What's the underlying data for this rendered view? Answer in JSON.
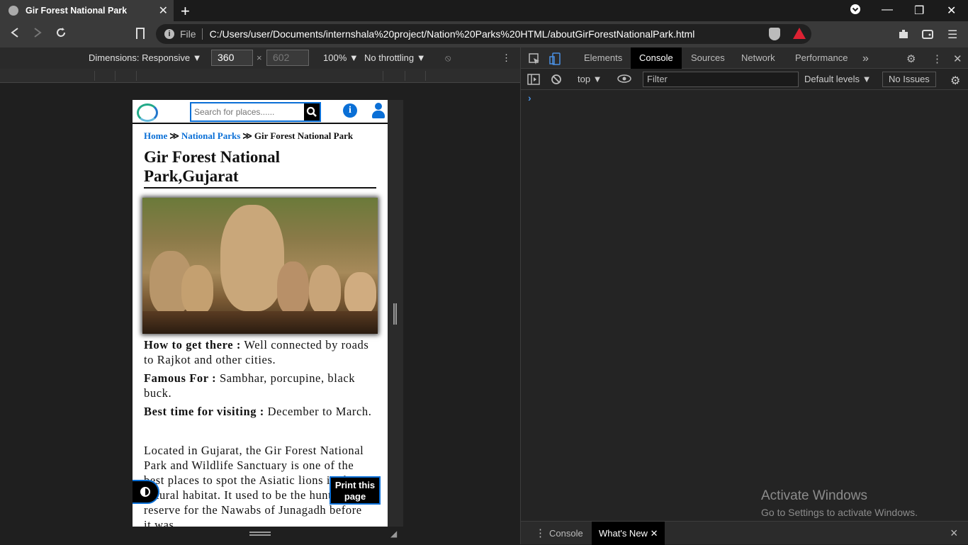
{
  "browser": {
    "tab_title": "Gir Forest National Park",
    "tab_close": "✕",
    "new_tab": "+",
    "url_scheme_label": "File",
    "url": "C:/Users/user/Documents/internshala%20project/Nation%20Parks%20HTML/aboutGirForestNationalPark.html"
  },
  "device_toolbar": {
    "dimensions_label": "Dimensions: Responsive ▼",
    "width": "360",
    "times": "×",
    "height": "602",
    "zoom": "100% ▼",
    "throttling": "No throttling ▼"
  },
  "page": {
    "search_placeholder": "Search for places......",
    "breadcrumb": [
      "Home",
      "National Parks",
      "Gir Forest National Park"
    ],
    "breadcrumb_sep": "≫",
    "title": "Gir Forest National Park,Gujarat",
    "facts": [
      {
        "label": "How to get there :",
        "value": " Well connected by roads to Rajkot and other cities."
      },
      {
        "label": "Famous For :",
        "value": " Sambhar, porcupine, black buck."
      },
      {
        "label": "Best time for visiting :",
        "value": " December to March."
      }
    ],
    "description": "Located in Gujarat, the Gir Forest National Park and Wildlife Sanctuary is one of the best places to spot the Asiatic lions in their natural habitat. It used to be the hunting reserve for the Nawabs of Junagadh before it was",
    "print_button": "Print this page"
  },
  "devtools": {
    "tabs": [
      "Elements",
      "Console",
      "Sources",
      "Network",
      "Performance"
    ],
    "active_tab": "Console",
    "more_tabs": "»",
    "context": "top ▼",
    "filter_placeholder": "Filter",
    "levels": "Default levels ▼",
    "issues": "No Issues",
    "prompt": "›",
    "drawer_tabs": [
      "Console",
      "What's New"
    ],
    "drawer_close": "×"
  },
  "watermark": {
    "line1": "Activate Windows",
    "line2": "Go to Settings to activate Windows."
  },
  "colors": {
    "link_blue": "#0a6fd6",
    "devtools_bg": "#242424"
  }
}
